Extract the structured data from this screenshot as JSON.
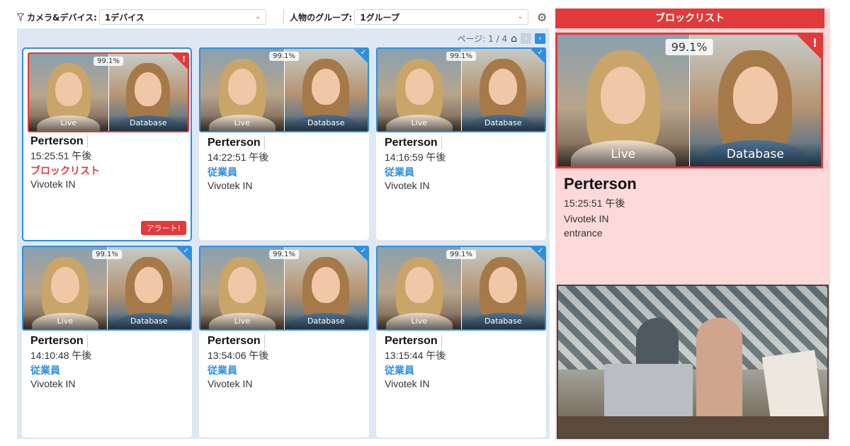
{
  "filters": {
    "camera_label": "カメラ&デバイス:",
    "camera_value": "1デバイス",
    "group_label": "人物のグループ:",
    "group_value": "1グループ"
  },
  "pager": {
    "text": "ページ: 1 / 4"
  },
  "face_labels": {
    "live": "Live",
    "database": "Database"
  },
  "cards": [
    {
      "score": "99.1%",
      "name": "Perterson",
      "time": "15:25:51 午後",
      "group": "ブロックリスト",
      "device": "Vivotek IN",
      "alert": "アラート!",
      "status": "blocklist"
    },
    {
      "score": "99.1%",
      "name": "Perterson",
      "time": "14:22:51 午後",
      "group": "従業員",
      "device": "Vivotek IN",
      "status": "employee"
    },
    {
      "score": "99.1%",
      "name": "Perterson",
      "time": "14:16:59 午後",
      "group": "従業員",
      "device": "Vivotek IN",
      "status": "employee"
    },
    {
      "score": "99.1%",
      "name": "Perterson",
      "time": "14:10:48 午後",
      "group": "従業員",
      "device": "Vivotek IN",
      "status": "employee"
    },
    {
      "score": "99.1%",
      "name": "Perterson",
      "time": "13:54:06 午後",
      "group": "従業員",
      "device": "Vivotek IN",
      "status": "employee"
    },
    {
      "score": "99.1%",
      "name": "Perterson",
      "time": "13:15:44 午後",
      "group": "従業員",
      "device": "Vivotek IN",
      "status": "employee"
    }
  ],
  "detail": {
    "header": "ブロックリスト",
    "score": "99.1%",
    "name": "Perterson",
    "time": "15:25:51 午後",
    "device": "Vivotek IN",
    "location": "entrance"
  },
  "colors": {
    "accent": "#2f8fe0",
    "alert": "#e23a3a",
    "detail_bg": "#fdd9d9",
    "grid_bg": "#dde8f4"
  },
  "icons": {
    "filter": "funnel-icon",
    "settings": "gear-icon",
    "home": "home-icon",
    "prev": "chevron-left-icon",
    "next": "chevron-right-icon"
  }
}
